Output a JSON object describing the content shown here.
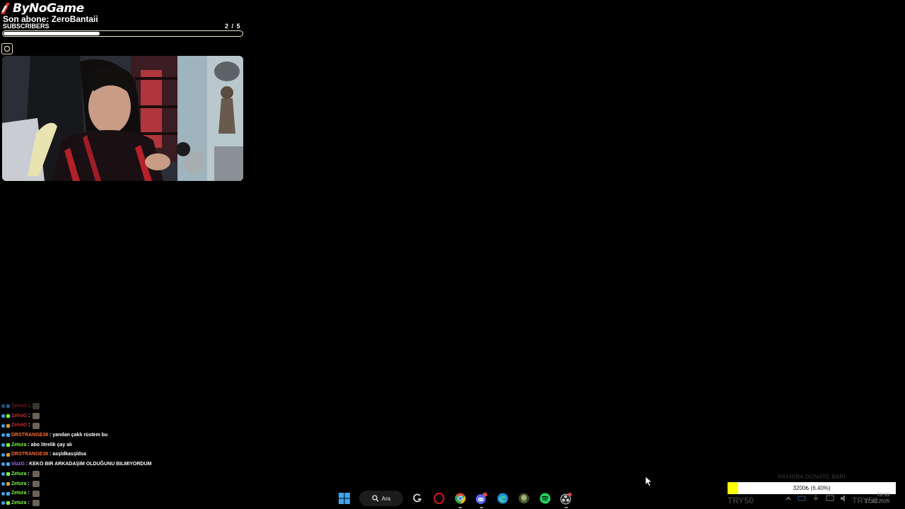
{
  "overlay": {
    "brand": "ByNoGame",
    "latest_sub_prefix": "Son abone:",
    "latest_sub_name": "ZeroBantaii",
    "goal_label": "SUBSCRIBERS",
    "goal_count": "2 / 5",
    "goal_progress": 0.4
  },
  "chat": {
    "lines": [
      {
        "user": "ZehoG",
        "color": "#d22a2a",
        "msg": "",
        "emote": true,
        "faded": true
      },
      {
        "user": "ZehoG",
        "color": "#d22a2a",
        "msg": "",
        "emote": true,
        "faded": false
      },
      {
        "user": "ZehoG",
        "color": "#d22a2a",
        "msg": "",
        "emote": true,
        "faded": false
      },
      {
        "user": "DRSTRANGE38",
        "color": "#ff6a2a",
        "msg": "yandan çaklı rüstem bu",
        "emote": false,
        "faded": false
      },
      {
        "user": "Zetura",
        "color": "#7cfc3c",
        "msg": "abo litrelik çay alı",
        "emote": false,
        "faded": false
      },
      {
        "user": "DRSTRANGE38",
        "color": "#ff6a2a",
        "msg": "asşldkasşldsa",
        "emote": false,
        "faded": false
      },
      {
        "user": "VizzG",
        "color": "#b46cff",
        "msg": "KEKO BIR ARKADAŞIM OLDUĞUNU BILMIYORDUM",
        "emote": false,
        "faded": false
      },
      {
        "user": "Zetura",
        "color": "#7cfc3c",
        "msg": "",
        "emote": true,
        "faded": false
      },
      {
        "user": "Zetura",
        "color": "#7cfc3c",
        "msg": "",
        "emote": true,
        "faded": false
      },
      {
        "user": "Zetura",
        "color": "#7cfc3c",
        "msg": "",
        "emote": true,
        "faded": false
      },
      {
        "user": "Zetura",
        "color": "#7cfc3c",
        "msg": "",
        "emote": true,
        "faded": false
      }
    ]
  },
  "donate": {
    "title": "HAYRINA DONATE BARI",
    "amount_text": "3200₺ (6.40%)",
    "progress": 0.064,
    "code_left": "TRY50",
    "code_right": "TRY50"
  },
  "taskbar": {
    "search_label": "Ara",
    "apps": [
      "windows-start-icon",
      "search",
      "gx-icon",
      "opera-icon",
      "chrome-icon",
      "discord-icon",
      "edge-icon",
      "game-icon",
      "spotify-icon",
      "obs-icon"
    ]
  },
  "clock": {
    "time": "19:33",
    "date": "17.02.2026"
  },
  "colors": {
    "background": "#000000",
    "donate_fill": "#ffff00",
    "goal_border": "#e9e3c4"
  }
}
